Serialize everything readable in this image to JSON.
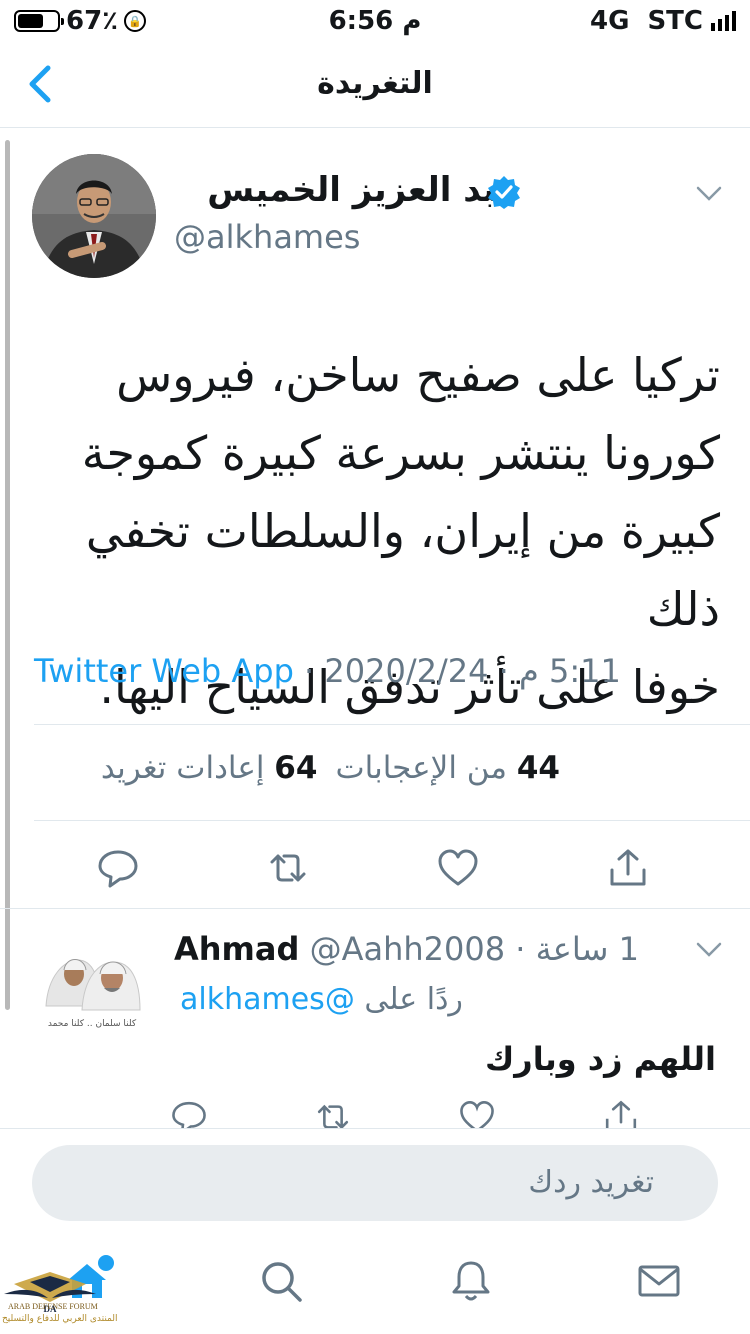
{
  "status_bar": {
    "battery": "67٪",
    "battery_level": 0.67,
    "time": "6:56 م",
    "network": "4G",
    "carrier": "STC"
  },
  "nav": {
    "title": "التغريدة",
    "back_icon": "chevron-left-icon"
  },
  "tweet": {
    "author_name": "عبد العزيز الخميس",
    "verified": true,
    "handle": "@alkhames",
    "text_lines": [
      "تركيا على صفيح ساخن، فيروس",
      "كورونا ينتشر بسرعة كبيرة كموجة",
      "كبيرة من إيران، والسلطات تخفي ذلك",
      "خوفا على تأثر تدفق السياح اليها."
    ],
    "time": "5:11 م",
    "date": "2020/2/24",
    "separator": "·",
    "source": "Twitter Web App",
    "likes_count": "44",
    "likes_label": "من الإعجابات",
    "retweets_count": "64",
    "retweets_label": "إعادات تغريد"
  },
  "reply": {
    "name": "Ahmad",
    "handle": "@Aahh2008",
    "separator": "·",
    "time_ago": "1 ساعة",
    "replying_label": "ردًا على",
    "replying_to": "@alkhames",
    "text": "اللهم زد وبارك",
    "avatar_caption": "كلنا سلمان .. كلنا محمد"
  },
  "composer": {
    "placeholder": "تغريد ردك"
  },
  "watermark": {
    "logo_text": "DA",
    "line1": "ARAB DEFENSE FORUM",
    "line2": "المنتدى العربي للدفاع والتسليح"
  },
  "colors": {
    "accent": "#1da1f2",
    "text": "#14171a",
    "muted": "#657786",
    "divider": "#e1e8ed"
  }
}
